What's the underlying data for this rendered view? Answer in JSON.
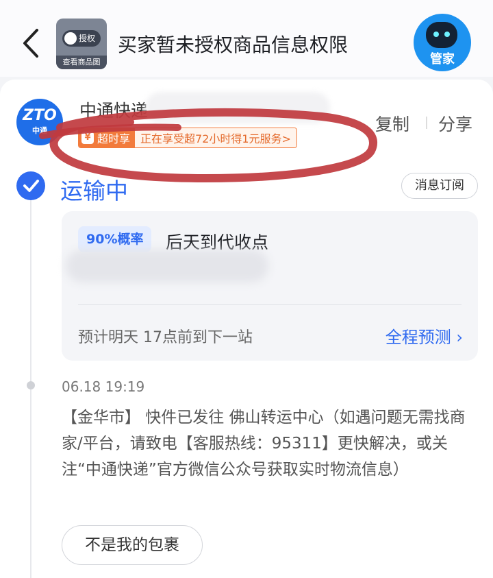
{
  "header": {
    "title": "买家暂未授权商品信息权限",
    "auth_thumb": {
      "toggle_label": "授权",
      "caption": "查看商品图"
    },
    "butler_label": "管家"
  },
  "courier": {
    "logo_text": "ZTO",
    "logo_subtext": "中通",
    "name": "中通快递",
    "copy_label": "复制",
    "share_label": "分享"
  },
  "promo": {
    "tag": "超时享",
    "icon_glyph": "¥",
    "text": "正在享受超72小时得1元服务>",
    "annotation_color": "#c0393e"
  },
  "status": {
    "title": "运输中",
    "subscribe_label": "消息订阅"
  },
  "eta": {
    "probability": "90%概率",
    "arrival": "后天到代收点",
    "next_stop": "预计明天 17点前到下一站",
    "forecast_label": "全程预测 ›"
  },
  "event": {
    "time": "06.18 19:19",
    "description": "【金华市】 快件已发往 佛山转运中心（如遇问题无需找商家/平台，请致电【客服热线：95311】更快解决，或关注“中通快递”官方微信公众号获取实时物流信息）"
  },
  "actions": {
    "not_mine_label": "不是我的包裹"
  },
  "colors": {
    "accent": "#2f6af0",
    "promo_orange": "#f27b3c",
    "page_bg": "#f3f4f7"
  }
}
